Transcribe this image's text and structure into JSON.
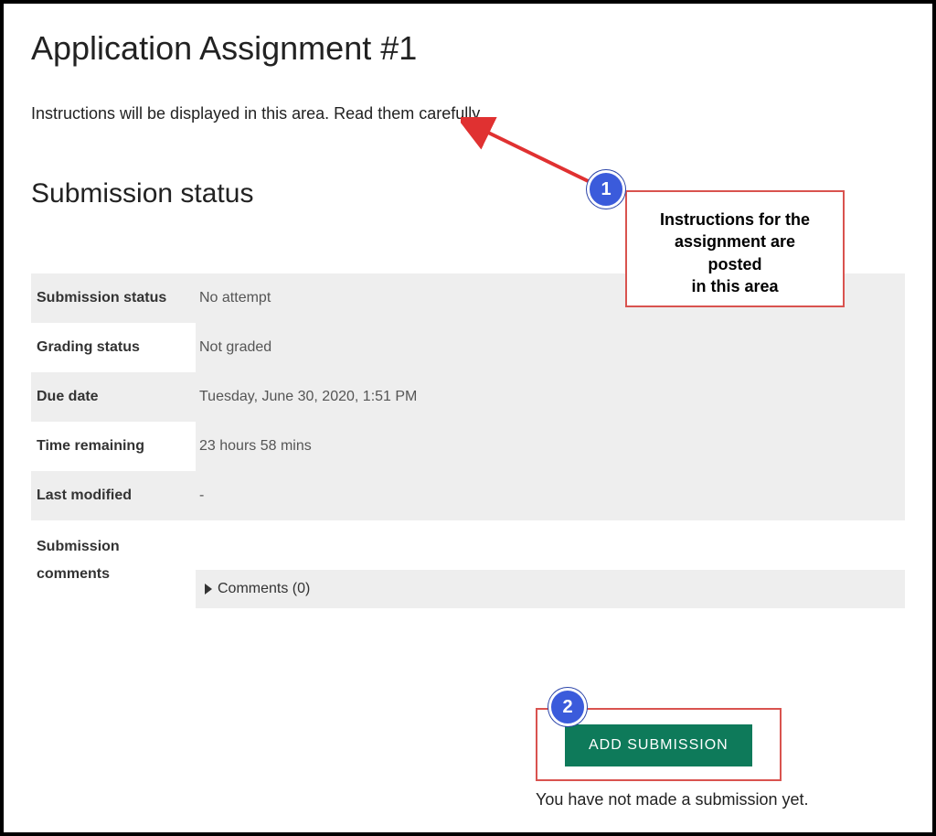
{
  "page": {
    "title": "Application Assignment #1",
    "instructions": "Instructions will be displayed in this area. Read them carefully.",
    "section_title": "Submission status"
  },
  "status": {
    "submission_status_label": "Submission status",
    "submission_status_value": "No attempt",
    "grading_status_label": "Grading status",
    "grading_status_value": "Not graded",
    "due_date_label": "Due date",
    "due_date_value": "Tuesday, June 30, 2020, 1:51 PM",
    "time_remaining_label": "Time remaining",
    "time_remaining_value": "23 hours 58 mins",
    "last_modified_label": "Last modified",
    "last_modified_value": "-",
    "comments_label": "Submission comments",
    "comments_toggle": "Comments (0)"
  },
  "submit": {
    "button_label": "ADD SUBMISSION",
    "hint": "You have not made a submission yet."
  },
  "annotations": {
    "callout1_line1": "Instructions for the",
    "callout1_line2": "assignment are posted",
    "callout1_line3": "in this area",
    "badge1": "1",
    "badge2": "2"
  }
}
